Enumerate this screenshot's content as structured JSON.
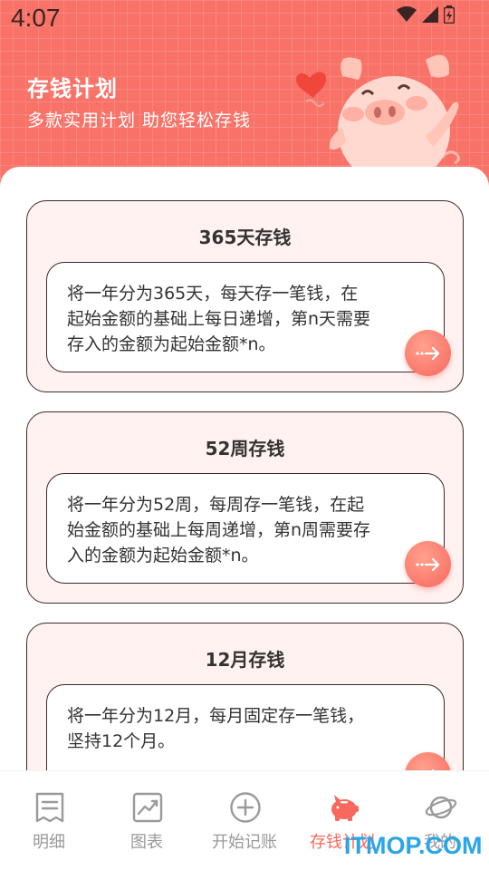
{
  "status_bar": {
    "time": "4:07"
  },
  "header": {
    "title": "存钱计划",
    "subtitle": "多款实用计划 助您轻松存钱"
  },
  "plans": [
    {
      "title": "365天存钱",
      "lines": [
        "将一年分为365天，每天存一笔钱，在",
        "起始金额的基础上每日递增，第n天需要",
        "存入的金额为起始金额*n。"
      ]
    },
    {
      "title": "52周存钱",
      "lines": [
        "将一年分为52周，每周存一笔钱，在起",
        "始金额的基础上每周递增，第n周需要存",
        "入的金额为起始金额*n。"
      ]
    },
    {
      "title": "12月存钱",
      "lines": [
        "将一年分为12月，每月固定存一笔钱，",
        "坚持12个月。"
      ]
    }
  ],
  "bottom_nav": {
    "items": [
      {
        "label": "明细",
        "icon": "receipt-icon",
        "active": false
      },
      {
        "label": "图表",
        "icon": "chart-icon",
        "active": false
      },
      {
        "label": "开始记账",
        "icon": "add-circle-icon",
        "active": false
      },
      {
        "label": "存钱计划",
        "icon": "piggy-bank-icon",
        "active": true
      },
      {
        "label": "我的",
        "icon": "planet-icon",
        "active": false
      }
    ]
  },
  "watermark": "ITMOP.COM",
  "colors": {
    "accent": "#f8685c",
    "header_bg": "#f87268",
    "card_bg": "#fff2f0",
    "watermark": "#2aa5e8"
  }
}
